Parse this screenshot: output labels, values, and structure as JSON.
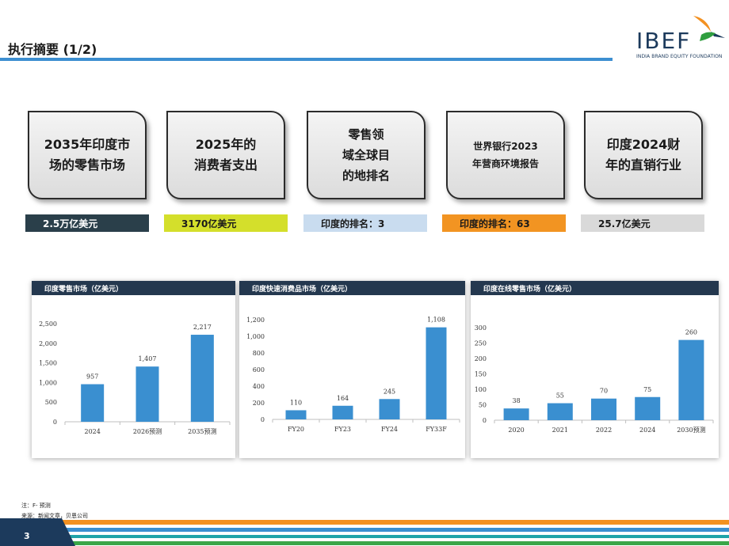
{
  "header": {
    "title": "执行摘要 (1/2)",
    "logo_word": "IBEF",
    "logo_sub": "INDIA BRAND EQUITY FOUNDATION"
  },
  "cards": [
    {
      "label": "2035年印度市\n场的零售市场",
      "tag": "2.5万亿美元",
      "tag_bg": "#2a3f4a",
      "tag_color": "#ffffff"
    },
    {
      "label": "2025年的\n消费者支出",
      "tag": "3170亿美元",
      "tag_bg": "#d4df2b",
      "tag_color": "#1a1a1a"
    },
    {
      "label": "零售领\n域全球目\n的地排名",
      "tag": "印度的排名：3",
      "tag_bg": "#c9dcef",
      "tag_color": "#1a1a1a"
    },
    {
      "label": "世界银行2023\n年营商环境报告",
      "tag": "印度的排名：63",
      "tag_bg": "#f29422",
      "tag_color": "#1a1a1a"
    },
    {
      "label": "印度2024财\n年的直销行业",
      "tag": "25.7亿美元",
      "tag_bg": "#d9d9d9",
      "tag_color": "#1a1a1a"
    }
  ],
  "chart_data": [
    {
      "type": "bar",
      "title": "印度零售市场（亿美元）",
      "categories": [
        "2024",
        "2026预测",
        "2035预测"
      ],
      "values": [
        957,
        1407,
        2217
      ],
      "value_labels": [
        "957",
        "1,407",
        "2,217"
      ],
      "ylim": [
        0,
        2500
      ],
      "yticks": [
        "0",
        "500",
        "1,000",
        "1,500",
        "2,000",
        "2,500"
      ],
      "color": "#3a8fd0"
    },
    {
      "type": "bar",
      "title": "印度快速消费品市场（亿美元）",
      "categories": [
        "FY20",
        "FY23",
        "FY24",
        "FY33F"
      ],
      "values": [
        110,
        164,
        245,
        1108
      ],
      "value_labels": [
        "110",
        "164",
        "245",
        "1,108"
      ],
      "ylim": [
        0,
        1200
      ],
      "yticks": [
        "0",
        "200",
        "400",
        "600",
        "800",
        "1,000",
        "1,200"
      ],
      "color": "#3a8fd0"
    },
    {
      "type": "bar",
      "title": "印度在线零售市场（亿美元）",
      "categories": [
        "2020",
        "2021",
        "2022",
        "2024",
        "2030预测"
      ],
      "values": [
        38,
        55,
        70,
        75,
        260
      ],
      "value_labels": [
        "38",
        "55",
        "70",
        "75",
        "260"
      ],
      "ylim": [
        0,
        300
      ],
      "yticks": [
        "0",
        "50",
        "100",
        "150",
        "200",
        "250",
        "300"
      ],
      "color": "#3a8fd0"
    }
  ],
  "footer": {
    "note": "注：F- 预测",
    "source": "来源：新闻文章，贝恩公司",
    "page": "3"
  }
}
